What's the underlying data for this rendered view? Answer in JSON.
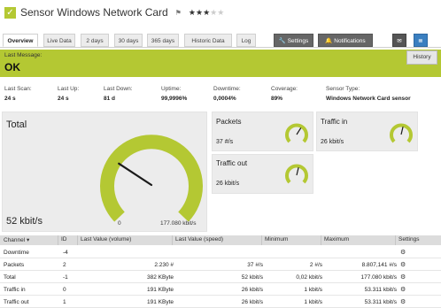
{
  "header": {
    "title": "Sensor Windows Network Card",
    "rating": 3,
    "rating_max": 5
  },
  "tabs": [
    {
      "label": "Overview",
      "active": true
    },
    {
      "label": "Live Data"
    },
    {
      "label": "2 days"
    },
    {
      "label": "30 days"
    },
    {
      "label": "365 days"
    },
    {
      "label": "Historic Data"
    },
    {
      "label": "Log"
    },
    {
      "label": "Settings",
      "icon": "wrench-icon"
    },
    {
      "label": "Notifications",
      "icon": "bell-icon"
    }
  ],
  "last_message": {
    "label": "Last Message:",
    "value": "OK",
    "history_label": "History"
  },
  "stats": [
    {
      "label": "Last Scan:",
      "value": "24 s"
    },
    {
      "label": "Last Up:",
      "value": "24 s"
    },
    {
      "label": "Last Down:",
      "value": "81 d"
    },
    {
      "label": "Uptime:",
      "value": "99,9996%"
    },
    {
      "label": "Downtime:",
      "value": "0,0004%"
    },
    {
      "label": "Coverage:",
      "value": "89%"
    },
    {
      "label": "Sensor Type:",
      "value": "Windows Network Card sensor"
    }
  ],
  "total_panel": {
    "title": "Total",
    "value": "52 kbit/s",
    "gauge_min": "0",
    "gauge_max": "177.080 kbit/s",
    "fraction": 0.29
  },
  "small_panels": [
    {
      "title": "Packets",
      "value": "37 #/s",
      "fraction": 0.62
    },
    {
      "title": "Traffic in",
      "value": "26 kbit/s",
      "fraction": 0.55
    },
    {
      "title": "Traffic out",
      "value": "26 kbit/s",
      "fraction": 0.55
    }
  ],
  "table": {
    "headers": [
      "Channel",
      "ID",
      "Last Value (volume)",
      "Last Value (speed)",
      "Minimum",
      "Maximum",
      "Settings"
    ],
    "rows": [
      {
        "channel": "Downtime",
        "id": "-4",
        "volume": "",
        "speed": "",
        "min": "",
        "max": ""
      },
      {
        "channel": "Packets",
        "id": "2",
        "volume": "2.230 #",
        "speed": "37 #/s",
        "min": "2 #/s",
        "max": "8.807,141 #/s"
      },
      {
        "channel": "Total",
        "id": "-1",
        "volume": "382 KByte",
        "speed": "52 kbit/s",
        "min": "0,02 kbit/s",
        "max": "177.080 kbit/s"
      },
      {
        "channel": "Traffic in",
        "id": "0",
        "volume": "191 KByte",
        "speed": "26 kbit/s",
        "min": "1 kbit/s",
        "max": "53.311 kbit/s"
      },
      {
        "channel": "Traffic out",
        "id": "1",
        "volume": "191 KByte",
        "speed": "26 kbit/s",
        "min": "1 kbit/s",
        "max": "53.311 kbit/s"
      }
    ]
  },
  "colors": {
    "accent": "#b4c833",
    "panel_bg": "#ececec",
    "header_bg": "#dcdcdc"
  }
}
